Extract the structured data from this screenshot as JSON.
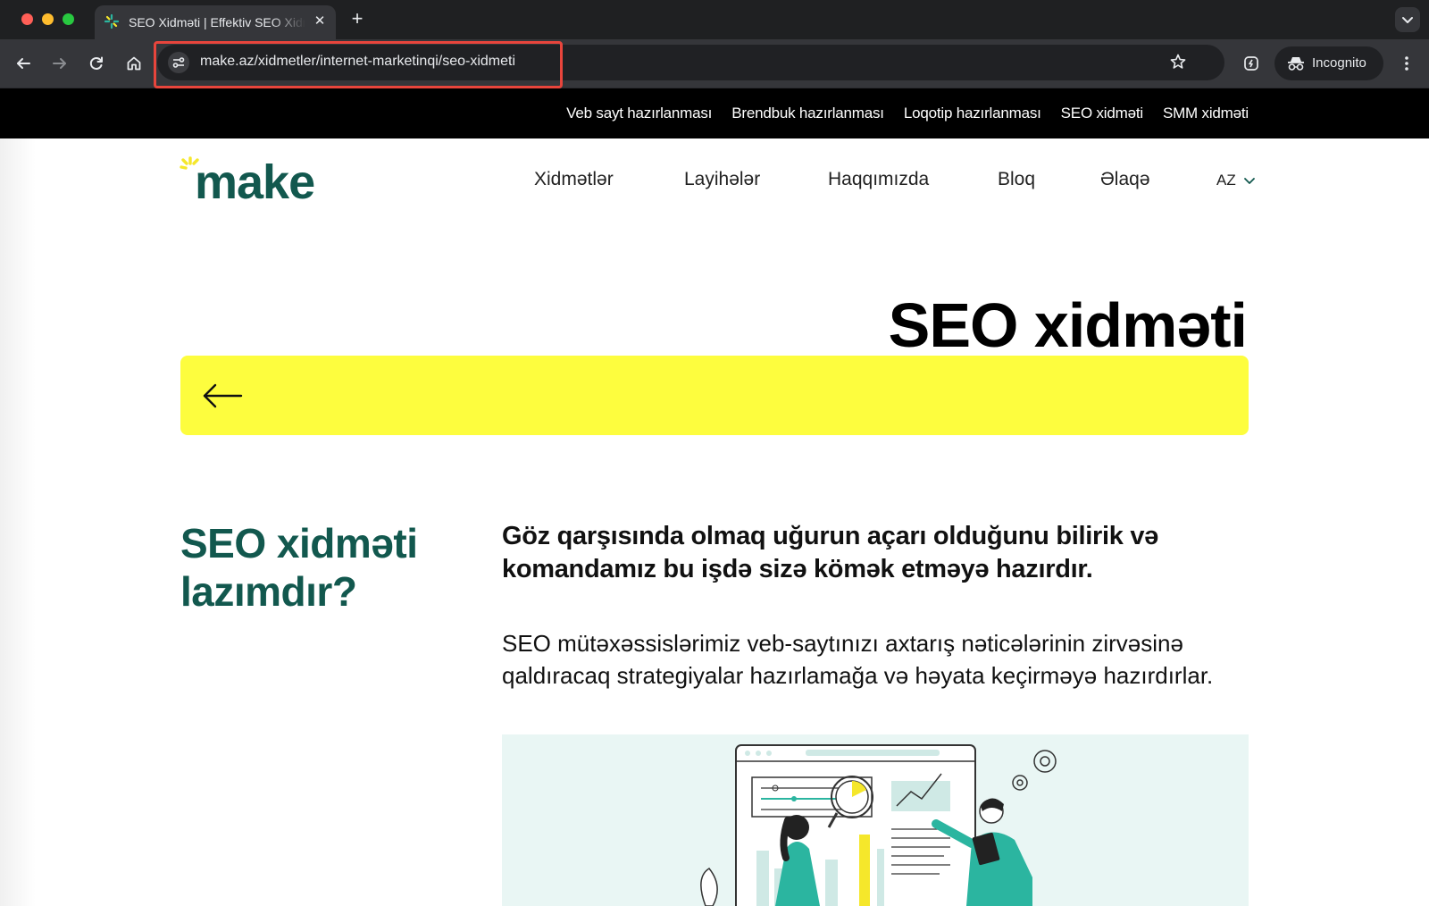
{
  "browser": {
    "tab_title": "SEO Xidməti | Effektiv SEO Xidmətləri",
    "new_tab_label": "+",
    "close_label": "✕",
    "url": "make.az/xidmetler/internet-marketinqi/seo-xidmeti",
    "incognito_label": "Incognito"
  },
  "topnav": {
    "items": [
      "Veb sayt hazırlanması",
      "Brendbuk hazırlanması",
      "Loqotip hazırlanması",
      "SEO xidməti",
      "SMM xidməti"
    ]
  },
  "logo": {
    "text": "make"
  },
  "mainnav": {
    "items": [
      "Xidmətlər",
      "Layihələr",
      "Haqqımızda",
      "Bloq",
      "Əlaqə"
    ],
    "language": "AZ"
  },
  "hero": {
    "title": "SEO xidməti"
  },
  "content": {
    "side_title": "SEO xidməti lazımdır?",
    "lead": "Göz qarşısında olmaq uğurun açarı olduğunu bilirik və komandamız bu işdə sizə kömək etməyə hazırdır.",
    "body": "SEO mütəxəssislərimiz veb-saytınızı axtarış nəticələrinin zirvəsinə qaldıracaq strategiyalar hazırlamağa və həyata keçirməyə hazırdırlar."
  },
  "colors": {
    "brand_green": "#12584e",
    "accent_yellow": "#fdfd3e",
    "illustration_teal": "#2bb5a0"
  }
}
